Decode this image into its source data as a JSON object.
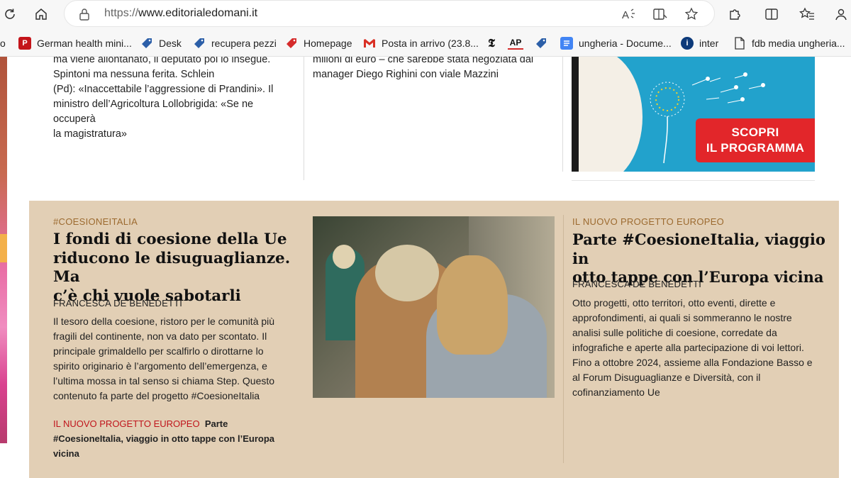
{
  "browser": {
    "url_scheme": "https://",
    "url_host": "www.editorialedomani.it",
    "address_icons": [
      "read-aloud-icon",
      "immersive-reader-icon",
      "favorite-star-icon"
    ],
    "toolbar_icons": [
      "extensions-icon",
      "split-screen-icon",
      "favorites-icon",
      "profile-icon"
    ]
  },
  "favorites": [
    {
      "label": "o",
      "icon": "none"
    },
    {
      "label": "German health mini...",
      "icon": "p-logo-icon",
      "color": "#c4141a"
    },
    {
      "label": "Desk",
      "icon": "tag-icon"
    },
    {
      "label": "recupera pezzi",
      "icon": "tag-icon"
    },
    {
      "label": "Homepage",
      "icon": "tag-icon"
    },
    {
      "label": "Posta in arrivo (23.8...",
      "icon": "gmail-icon"
    },
    {
      "label": "",
      "icon": "nyt-icon"
    },
    {
      "label": "",
      "icon": "ap-icon"
    },
    {
      "label": "",
      "icon": "tag-icon"
    },
    {
      "label": "ungheria - Docume...",
      "icon": "docs-icon"
    },
    {
      "label": "inter",
      "icon": "inter-icon"
    },
    {
      "label": "fdb media ungheria...",
      "icon": "page-icon"
    }
  ],
  "upper": {
    "left_snippet": [
      "ma viene allontanato, il deputato poi lo insegue.",
      "Spintoni ma nessuna ferita. Schlein",
      "(Pd): «Inaccettabile l’aggressione di Prandini». Il",
      "ministro dell’Agricoltura Lollobrigida: «Se ne occuperà",
      "la magistratura»"
    ],
    "middle_snippet": [
      "milioni di euro – che sarebbe stata negoziata dal",
      "manager Diego Righini con viale Mazzini"
    ],
    "ad_button": [
      "SCOPRI",
      "IL PROGRAMMA"
    ]
  },
  "feature": {
    "left": {
      "kicker": "#COESIONEITALIA",
      "headline": [
        "I fondi di coesione della Ue",
        "riducono le disuguaglianze. Ma",
        "c’è chi vuole sabotarli"
      ],
      "author": "FRANCESCA DE BENEDETTI",
      "body": [
        "Il tesoro della coesione, ristoro per le comunità più",
        "fragili del continente, non va dato per scontato. Il",
        "principale grimaldello per scalfirlo o dirottarne lo",
        "spirito originario è l’argomento dell’emergenza, e",
        "l’ultima mossa in tal senso si chiama Step. Questo",
        "contenuto fa parte del progetto #CoesioneItalia"
      ],
      "related_kicker": "IL NUOVO PROGETTO EUROPEO",
      "related_title": [
        "Parte",
        "#CoesioneItalia, viaggio in otto tappe con l’Europa",
        "vicina"
      ]
    },
    "right": {
      "kicker": "IL NUOVO PROGETTO EUROPEO",
      "headline": [
        "Parte #CoesioneItalia, viaggio in",
        "otto tappe con l’Europa vicina"
      ],
      "author": "FRANCESCA DE BENEDETTI",
      "body": [
        "Otto progetti, otto territori, otto eventi, dirette e",
        "approfondimenti, ai quali si sommeranno le nostre",
        "analisi sulle politiche di coesione, corredate da",
        "infografiche e aperte alla partecipazione di voi lettori.",
        "Fino a ottobre 2024, assieme alla Fondazione Basso e",
        "al Forum Disuguaglianze e Diversità, con il",
        "cofinanziamento Ue"
      ]
    }
  }
}
